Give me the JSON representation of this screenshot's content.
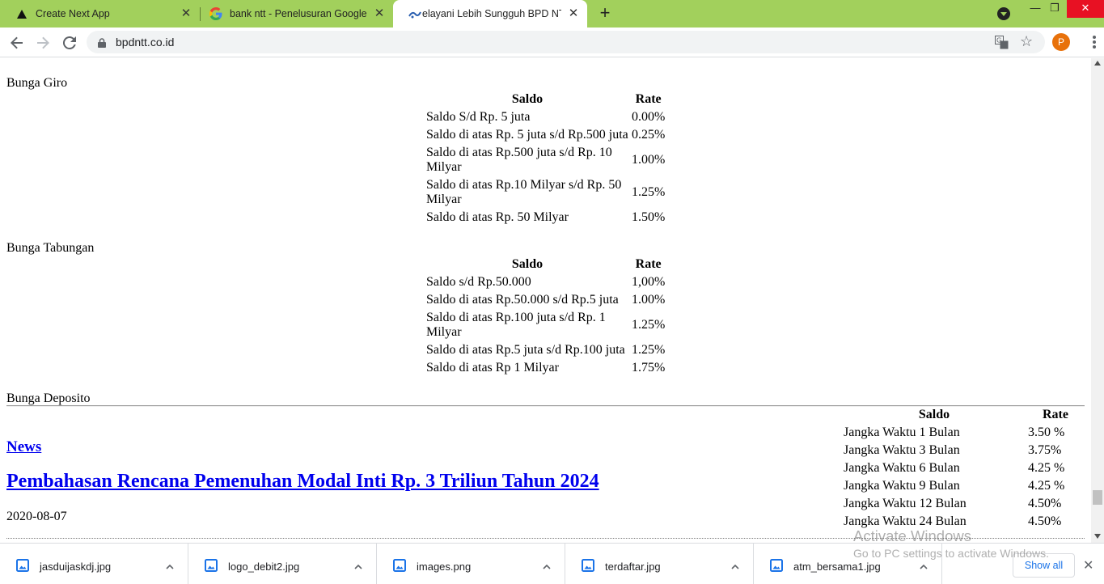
{
  "browser": {
    "tabs": [
      {
        "title": "Create Next App",
        "icon": "triangle-icon",
        "active": false
      },
      {
        "title": "bank ntt - Penelusuran Google",
        "icon": "google-icon",
        "active": false
      },
      {
        "title": "elayani Lebih Sungguh BPD NTT",
        "icon": "bank-logo-icon",
        "active": true
      }
    ],
    "new_tab_label": "+",
    "url": "bpdntt.co.id",
    "profile_initial": "P",
    "window_controls": {
      "minimize": "—",
      "maximize": "❐",
      "close": "✕"
    }
  },
  "page": {
    "giro": {
      "label": "Bunga Giro",
      "headers": [
        "Saldo",
        "Rate"
      ],
      "rows": [
        [
          "Saldo S/d Rp. 5 juta",
          "0.00%"
        ],
        [
          "Saldo di atas Rp. 5 juta s/d Rp.500 juta",
          "0.25%"
        ],
        [
          "Saldo di atas Rp.500 juta s/d Rp. 10 Milyar",
          "1.00%"
        ],
        [
          "Saldo di atas Rp.10 Milyar s/d Rp. 50 Milyar",
          "1.25%"
        ],
        [
          "Saldo di atas Rp. 50 Milyar",
          "1.50%"
        ]
      ]
    },
    "tabungan": {
      "label": "Bunga Tabungan",
      "headers": [
        "Saldo",
        "Rate"
      ],
      "rows": [
        [
          "Saldo s/d Rp.50.000",
          "1,00%"
        ],
        [
          "Saldo di atas Rp.50.000 s/d Rp.5 juta",
          "1.00%"
        ],
        [
          "Saldo di atas Rp.100 juta s/d Rp. 1 Milyar",
          "1.25%"
        ],
        [
          "Saldo di atas Rp.5 juta s/d Rp.100 juta",
          "1.25%"
        ],
        [
          "Saldo di atas Rp 1 Milyar",
          "1.75%"
        ]
      ]
    },
    "deposito": {
      "label": "Bunga Deposito",
      "headers": [
        "Saldo",
        "Rate"
      ],
      "rows": [
        [
          "Jangka Waktu 1 Bulan",
          "3.50 %"
        ],
        [
          "Jangka Waktu 3 Bulan",
          "3.75%"
        ],
        [
          "Jangka Waktu 6 Bulan",
          "4.25 %"
        ],
        [
          "Jangka Waktu 9 Bulan",
          "4.25 %"
        ],
        [
          "Jangka Waktu 12 Bulan",
          "4.50%"
        ],
        [
          "Jangka Waktu 24 Bulan",
          "4.50%"
        ]
      ]
    },
    "news": {
      "heading": "News",
      "article_title": "Pembahasan Rencana Pemenuhan Modal Inti Rp. 3 Triliun Tahun 2024",
      "article_date": "2020-08-07"
    }
  },
  "watermark": {
    "title": "Activate Windows",
    "subtitle": "Go to PC settings to activate Windows."
  },
  "downloads": {
    "items": [
      {
        "name": "jasduijaskdj.jpg"
      },
      {
        "name": "logo_debit2.jpg"
      },
      {
        "name": "images.png"
      },
      {
        "name": "terdaftar.jpg"
      },
      {
        "name": "atm_bersama1.jpg"
      }
    ],
    "show_all_label": "Show all",
    "close_label": "✕"
  }
}
